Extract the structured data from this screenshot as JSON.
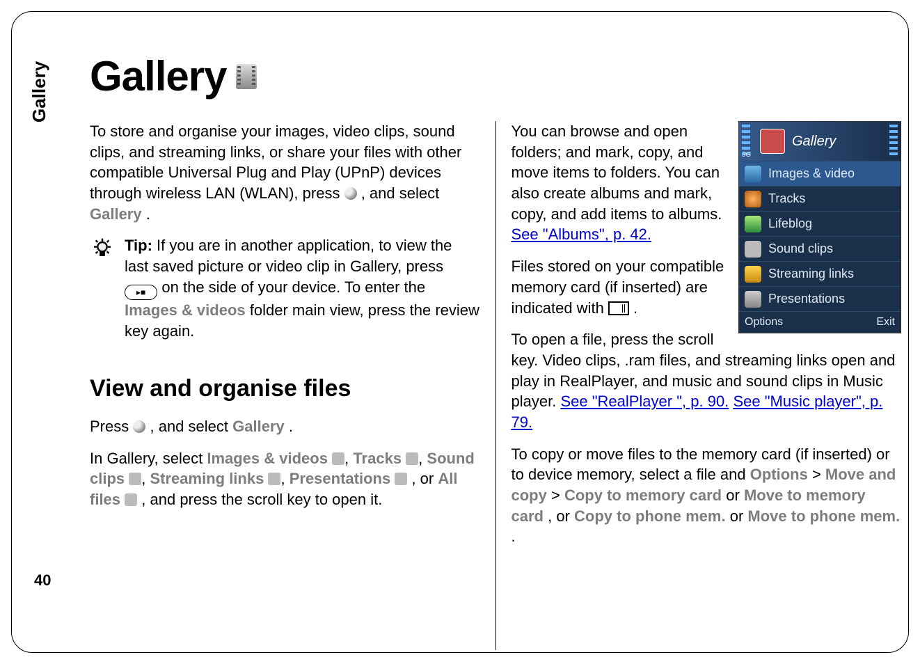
{
  "page": {
    "side_tab": "Gallery",
    "number": "40",
    "title": "Gallery"
  },
  "left": {
    "intro_a": "To store and organise your images, video clips, sound clips, and streaming links, or share your files with other compatible Universal Plug and Play (UPnP) devices through wireless LAN (WLAN), press ",
    "intro_b": " , and select ",
    "gallery_word": "Gallery",
    "intro_c": ".",
    "tip_label": "Tip:",
    "tip_a": " If you are in another application, to view the last saved picture or video clip in Gallery, press ",
    "tip_b": " on the side of your device. To enter the ",
    "images_videos": "Images & videos",
    "tip_c": " folder main view, press the review key again.",
    "section_title": "View and organise files",
    "press_a": "Press ",
    "press_b": " , and select ",
    "press_c": ".",
    "list_a": "In Gallery, select ",
    "lst_iv": "Images & videos",
    "lst_tracks": "Tracks",
    "lst_sound": "Sound clips",
    "lst_stream": "Streaming links",
    "lst_pres": "Presentations",
    "lst_or": ", or ",
    "lst_all": "All files",
    "list_b": ", and press the scroll key to open it.",
    "comma_sep": ", "
  },
  "right": {
    "para1_a": "You can browse and open folders; and mark, copy, and move items to folders. You can also create albums and mark, copy, and add items to albums. ",
    "link_albums": "See \"Albums\", p. 42.",
    "para2_a": "Files stored on your compatible memory card (if inserted) are indicated with ",
    "para2_b": ".",
    "para3_a": "To open a file, press the scroll key. Video clips, .ram files, and streaming links open and play in RealPlayer, and music and sound clips in Music player. ",
    "link_real": "See \"RealPlayer \", p. 90.",
    "space": " ",
    "link_music": "See \"Music player\", p. 79.",
    "para4_a": "To copy or move files to the memory card (if inserted) or to device memory, select a file and ",
    "opt_options": "Options",
    "gt": " > ",
    "opt_move": "Move and copy",
    "opt_cpmem": "Copy to memory card",
    "or_word": " or ",
    "opt_mvmem": "Move to memory card",
    "comma_or": ", or ",
    "opt_cpph": "Copy to phone mem.",
    "opt_mvph": "Move to phone mem.",
    "tail_dot": "."
  },
  "phone": {
    "title": "Gallery",
    "indicator": "3G",
    "items": [
      "Images & video",
      "Tracks",
      "Lifeblog",
      "Sound clips",
      "Streaming links",
      "Presentations"
    ],
    "soft_left": "Options",
    "soft_right": "Exit"
  }
}
